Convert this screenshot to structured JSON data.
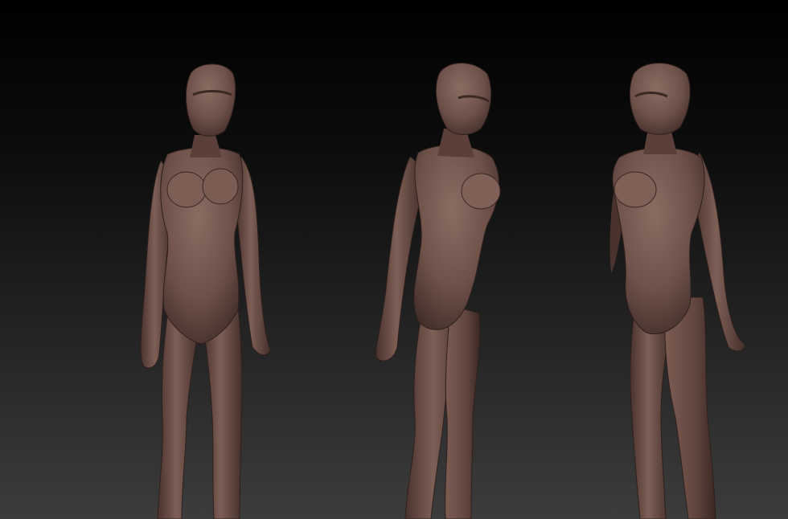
{
  "scene": {
    "background_top": "#000000",
    "background_bottom": "#3c3c3c",
    "material_color": "#6e524a",
    "material_highlight": "#8a6c62",
    "material_shadow": "#3e2a25",
    "views": [
      {
        "view": "front"
      },
      {
        "view": "side"
      },
      {
        "view": "three-quarter"
      }
    ]
  }
}
